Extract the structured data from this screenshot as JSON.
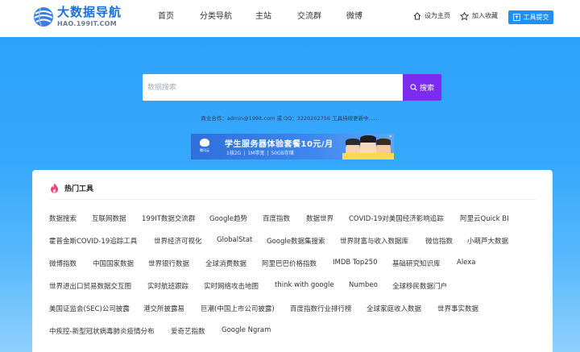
{
  "logo": {
    "title": "大数据导航",
    "subtitle": "HAO.199IT.COM"
  },
  "nav": [
    "首页",
    "分类导航",
    "主站",
    "交流群",
    "微博"
  ],
  "header_links": {
    "home": "设为主页",
    "favorite": "加入收藏",
    "submit": "工具提交"
  },
  "search": {
    "placeholder": "数据搜索",
    "button": "搜索"
  },
  "contact": "商业合作：admin@199it.com 或 QQ：3220202756 工具持续更新中……",
  "banner": {
    "brand": "腾讯云",
    "headline": "学生服务器体验套餐10元/月",
    "specs": [
      "1核2G",
      "1M带宽",
      "50GB存储"
    ],
    "close": "✕"
  },
  "card": {
    "title": "热门工具"
  },
  "tools": [
    [
      "数据搜索",
      "互联网数据",
      "199IT数据交流群",
      "Google趋势",
      "百度指数",
      "数据世界",
      "COVID-19对美国经济影响追踪",
      "阿里云Quick BI"
    ],
    [
      "霍普金斯COVID-19追踪工具",
      "世界经济可视化",
      "GlobalStat",
      "Google数据集搜索",
      "世界财富与收入数据库",
      "微信指数",
      "小萌芦大数据"
    ],
    [
      "微博指数",
      "中国国家数据",
      "世界银行数据",
      "全球消费数据",
      "阿里巴巴价格指数",
      "IMDB Top250",
      "基础研究知识库",
      "Alexa"
    ],
    [
      "世界进出口贸易数据交互图",
      "实时航班跟踪",
      "实时网络攻击地图",
      "think with google",
      "Numbeo",
      "全球移民数据门户"
    ],
    [
      "美国证监会(SEC)公司披露",
      "港交所披露易",
      "巨潮(中国上市公司披露)",
      "百度指数行业排行榜",
      "全球家庭收入数据",
      "世界事实数据"
    ],
    [
      "中疾控-新型冠状病毒肺炎疫情分布",
      "爱奇艺指数",
      "Google Ngram"
    ]
  ],
  "colors": {
    "brand_blue": "#1b6fd6",
    "submit_blue": "#1e90f5",
    "search_purple": "#7b2cf0",
    "hero_top": "#2ea2fb",
    "hero_bottom": "#8fd0fd",
    "fire_pink": "#f0457a"
  },
  "icons": {
    "logo": "globe-logo-icon",
    "home": "home-icon",
    "favorite": "star-icon",
    "submit": "upload-icon",
    "search": "search-icon",
    "hot": "fire-icon"
  }
}
